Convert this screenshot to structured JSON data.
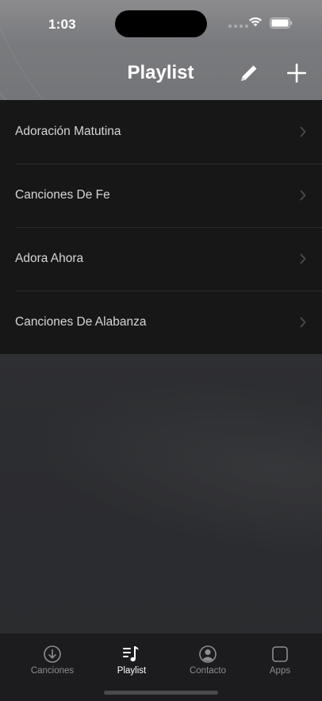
{
  "status_bar": {
    "time": "1:03"
  },
  "navigation": {
    "title": "Playlist",
    "icons": [
      "pencil-icon",
      "plus-icon"
    ]
  },
  "playlists": [
    {
      "label": "Adoración Matutina"
    },
    {
      "label": "Canciones De Fe"
    },
    {
      "label": "Adora Ahora"
    },
    {
      "label": "Canciones De Alabanza"
    }
  ],
  "tab_bar": {
    "tabs": [
      {
        "label": "Canciones",
        "icon": "download-circle-icon",
        "active": false
      },
      {
        "label": "Playlist",
        "icon": "music-list-icon",
        "active": true
      },
      {
        "label": "Contacto",
        "icon": "person-circle-icon",
        "active": false
      },
      {
        "label": "Apps",
        "icon": "square-icon",
        "active": false
      }
    ]
  },
  "colors": {
    "header_bg": "#7a7b7e",
    "list_bg": "#171717",
    "tab_bar_bg": "#1c1c1e",
    "active_tab": "#ffffff",
    "inactive_tab": "#8d8d92"
  }
}
